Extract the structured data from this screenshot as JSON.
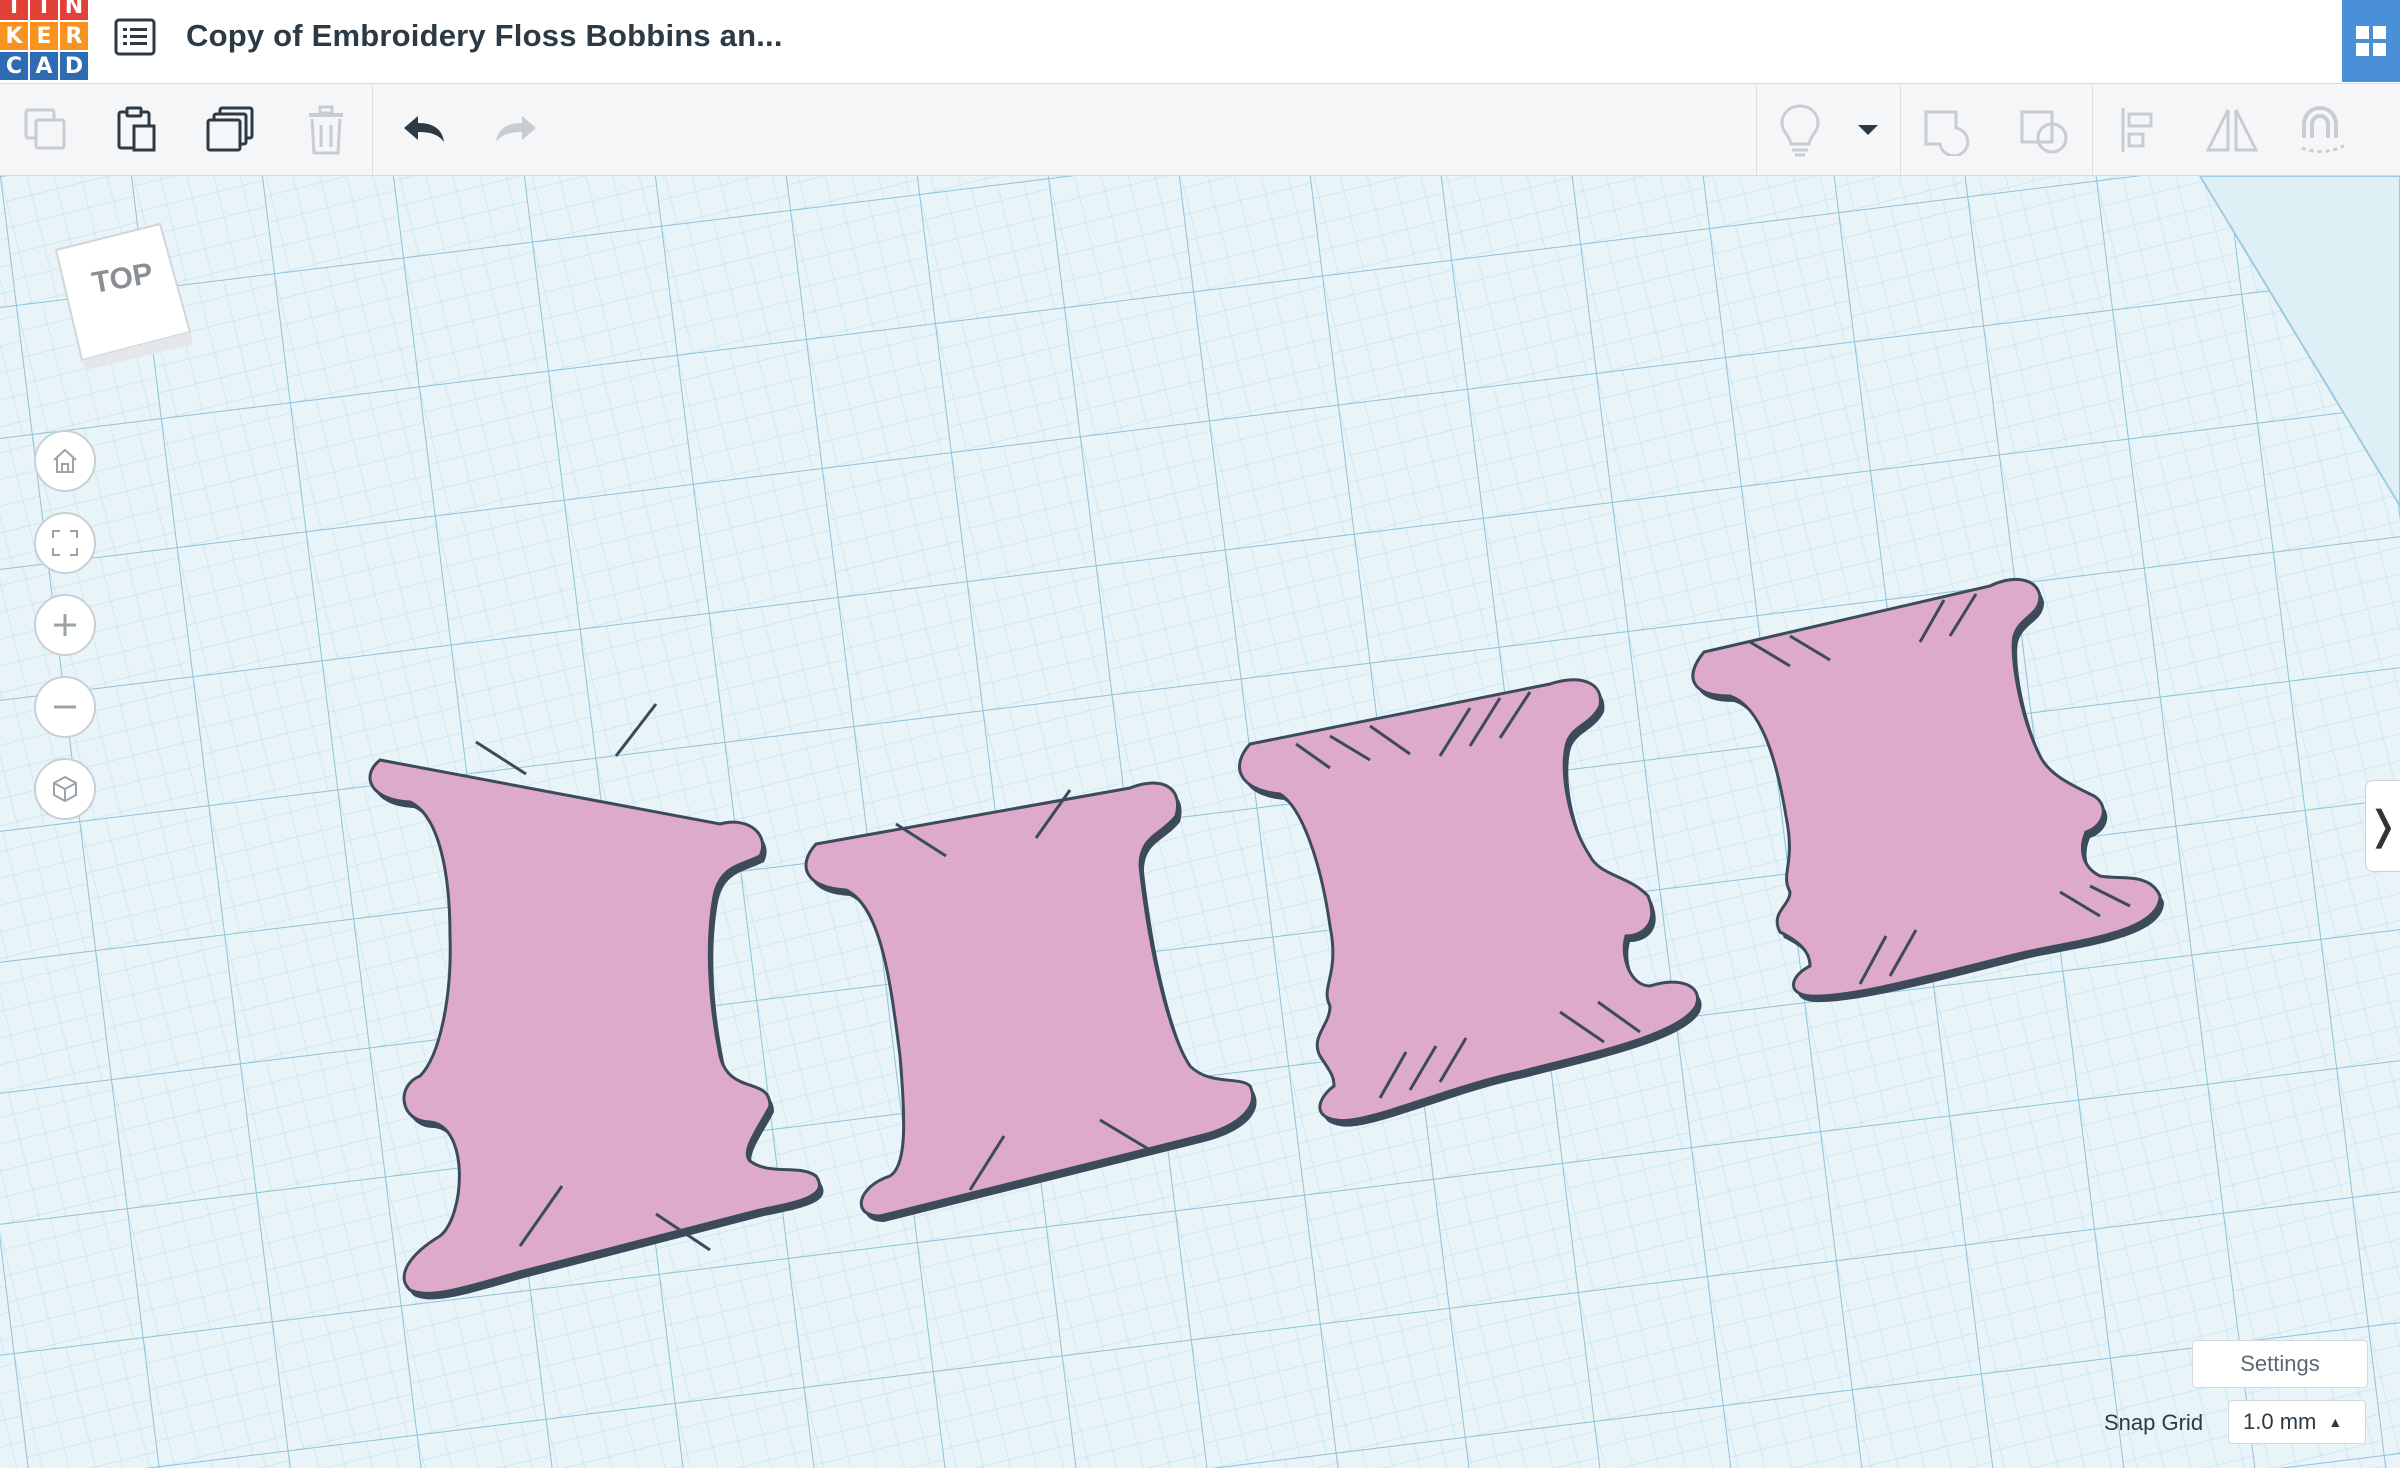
{
  "app": {
    "logo_letters": [
      "T",
      "I",
      "N",
      "K",
      "E",
      "R",
      "C",
      "A",
      "D"
    ],
    "logo_colors": [
      "#e2413a",
      "#e2413a",
      "#e2413a",
      "#f7931e",
      "#f7931e",
      "#f7931e",
      "#2d6cb3",
      "#2d6cb3",
      "#2d6cb3"
    ],
    "accent": "#4a90d9"
  },
  "header": {
    "title": "Copy of Embroidery Floss Bobbins an...",
    "menu_icon": "list-icon",
    "apps_icon": "grid-apps-icon"
  },
  "toolbar": {
    "left": [
      {
        "name": "copy",
        "icon": "copy-icon"
      },
      {
        "name": "paste",
        "icon": "clipboard-icon"
      },
      {
        "name": "duplicate",
        "icon": "duplicate-icon"
      },
      {
        "name": "delete",
        "icon": "trash-icon"
      },
      {
        "name": "undo",
        "icon": "undo-icon"
      },
      {
        "name": "redo",
        "icon": "redo-icon"
      }
    ],
    "right": [
      {
        "name": "notes",
        "icon": "lightbulb-icon"
      },
      {
        "name": "notes-dropdown",
        "icon": "caret-down-icon"
      },
      {
        "name": "group",
        "icon": "group-icon"
      },
      {
        "name": "ungroup",
        "icon": "ungroup-icon"
      },
      {
        "name": "align",
        "icon": "align-icon"
      },
      {
        "name": "mirror",
        "icon": "mirror-icon"
      },
      {
        "name": "cruise",
        "icon": "magnet-icon"
      }
    ]
  },
  "workplane": {
    "viewcube_label": "TOP",
    "grid_color": "#a9d3e6",
    "plane_color": "#e9f4f8",
    "shape_fill": "#ddaac9",
    "shape_edge": "#3c4a5a",
    "shape_count": 4
  },
  "nav": [
    {
      "name": "home-view",
      "icon": "home-icon"
    },
    {
      "name": "fit-view",
      "icon": "fit-view-icon"
    },
    {
      "name": "zoom-in",
      "icon": "plus-icon"
    },
    {
      "name": "zoom-out",
      "icon": "minus-icon"
    },
    {
      "name": "ortho-view",
      "icon": "cube-icon"
    }
  ],
  "footer": {
    "settings_label": "Settings",
    "snap_grid_label": "Snap Grid",
    "snap_grid_value": "1.0 mm"
  },
  "side_toggle": "❭"
}
